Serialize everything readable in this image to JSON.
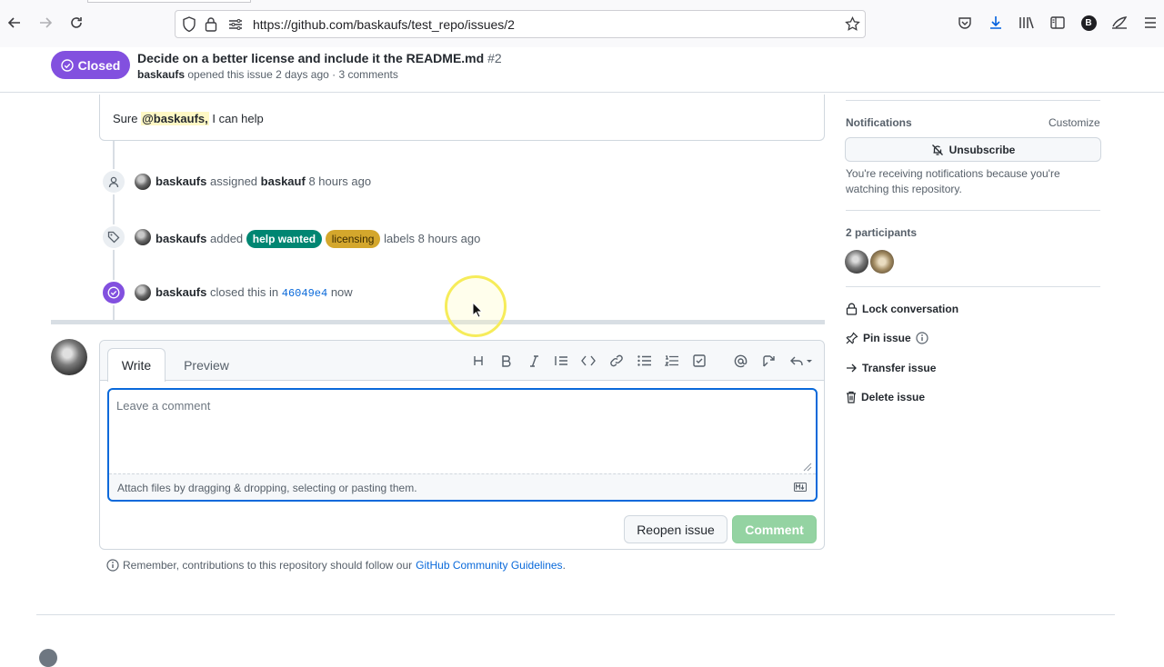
{
  "browser": {
    "url": "https://github.com/baskaufs/test_repo/issues/2",
    "profile_initial": "B"
  },
  "issue": {
    "state": "Closed",
    "title": "Decide on a better license and include it the README.md",
    "number": "#2",
    "author": "baskaufs",
    "meta_rest": "opened this issue 2 days ago · 3 comments"
  },
  "comment": {
    "prefix": "Sure",
    "mention": "@baskaufs,",
    "suffix": "I can help"
  },
  "timeline": {
    "assigned": {
      "actor": "baskaufs",
      "verb": "assigned",
      "target": "baskauf",
      "time": "8 hours ago"
    },
    "labeled": {
      "actor": "baskaufs",
      "verb": "added",
      "labels": [
        "help wanted",
        "licensing"
      ],
      "suffix": "labels",
      "time": "8 hours ago"
    },
    "closed": {
      "actor": "baskaufs",
      "verb": "closed this in",
      "commit": "46049e4",
      "time": "now"
    }
  },
  "form": {
    "tabs": [
      "Write",
      "Preview"
    ],
    "placeholder": "Leave a comment",
    "attach_text": "Attach files by dragging & dropping, selecting or pasting them.",
    "reopen_label": "Reopen issue",
    "comment_label": "Comment",
    "guidelines_prefix": "Remember, contributions to this repository should follow our",
    "guidelines_link": "GitHub Community Guidelines",
    "guidelines_suffix": "."
  },
  "sidebar": {
    "notifications_heading": "Notifications",
    "customize": "Customize",
    "unsubscribe": "Unsubscribe",
    "notif_reason": "You're receiving notifications because you're watching this repository.",
    "participants_heading": "2 participants",
    "actions": [
      "Lock conversation",
      "Pin issue",
      "Transfer issue",
      "Delete issue"
    ]
  },
  "colors": {
    "closed_purple": "#8250df",
    "help_wanted": "#008672",
    "licensing": "#d4a72c",
    "link_blue": "#0969da",
    "comment_green_disabled": "#94d3a2"
  }
}
